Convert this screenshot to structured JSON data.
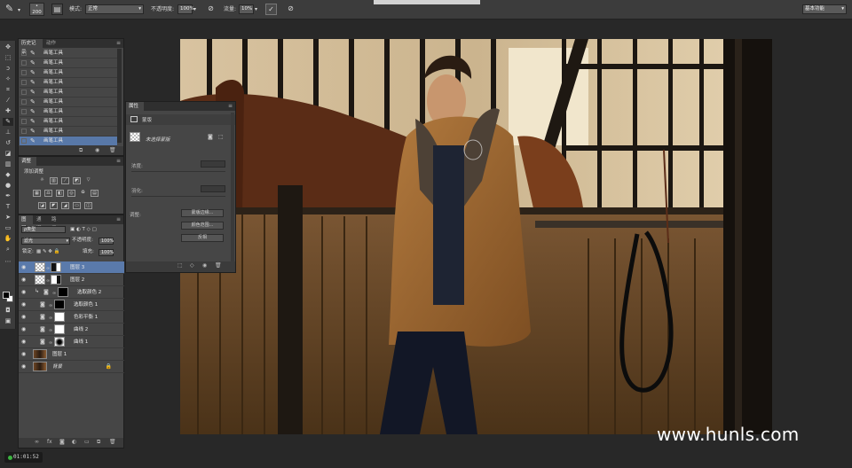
{
  "options_bar": {
    "brush_size": "200",
    "mode_label": "模式:",
    "mode_value": "正常",
    "opacity_label": "不透明度:",
    "opacity_value": "100%",
    "flow_label": "流量:",
    "flow_value": "10%",
    "workspace_value": "基本功能"
  },
  "history_panel": {
    "tabs": [
      "历史记录",
      "动作"
    ],
    "items": [
      "画笔工具",
      "画笔工具",
      "画笔工具",
      "画笔工具",
      "画笔工具",
      "画笔工具",
      "画笔工具",
      "画笔工具",
      "画笔工具",
      "画笔工具"
    ],
    "selected_index": 9
  },
  "adjustments_panel": {
    "tab": "调整",
    "title": "添加调整"
  },
  "layers_panel": {
    "tabs": [
      "图层",
      "通道",
      "路径"
    ],
    "filter_kind": "ρ类型",
    "blend_mode": "滤光",
    "opacity_label": "不透明度:",
    "opacity_value": "100%",
    "lock_label": "锁定:",
    "fill_label": "填充:",
    "fill_value": "100%",
    "layers": [
      {
        "name": "图层 3",
        "selected": true,
        "thumb": "checker",
        "mask": "black-white"
      },
      {
        "name": "图层 2",
        "selected": false,
        "thumb": "checker",
        "mask": "white-black"
      },
      {
        "name": "选取颜色 2",
        "selected": false,
        "thumb": "adj",
        "mask": "black"
      },
      {
        "name": "选取颜色 1",
        "selected": false,
        "thumb": "adj",
        "mask": "black-dots"
      },
      {
        "name": "色彩平衡 1",
        "selected": false,
        "thumb": "adj",
        "mask": "white"
      },
      {
        "name": "曲线 2",
        "selected": false,
        "thumb": "adj",
        "mask": "white"
      },
      {
        "name": "曲线 1",
        "selected": false,
        "thumb": "adj",
        "mask": "gradient"
      },
      {
        "name": "图层 1",
        "selected": false,
        "thumb": "photo",
        "mask": ""
      },
      {
        "name": "背景",
        "selected": false,
        "thumb": "photo",
        "mask": "",
        "locked": true
      }
    ]
  },
  "properties_panel": {
    "tab": "属性",
    "section": "蒙版",
    "mask_label": "未选择蒙版",
    "density_label": "浓度:",
    "feather_label": "羽化:",
    "refine_label": "调整:",
    "btn_mask_edge": "蒙版边缘...",
    "btn_color_range": "颜色范围...",
    "btn_invert": "反相"
  },
  "watermark": "www.hunls.com",
  "timecode": "01:01:52"
}
